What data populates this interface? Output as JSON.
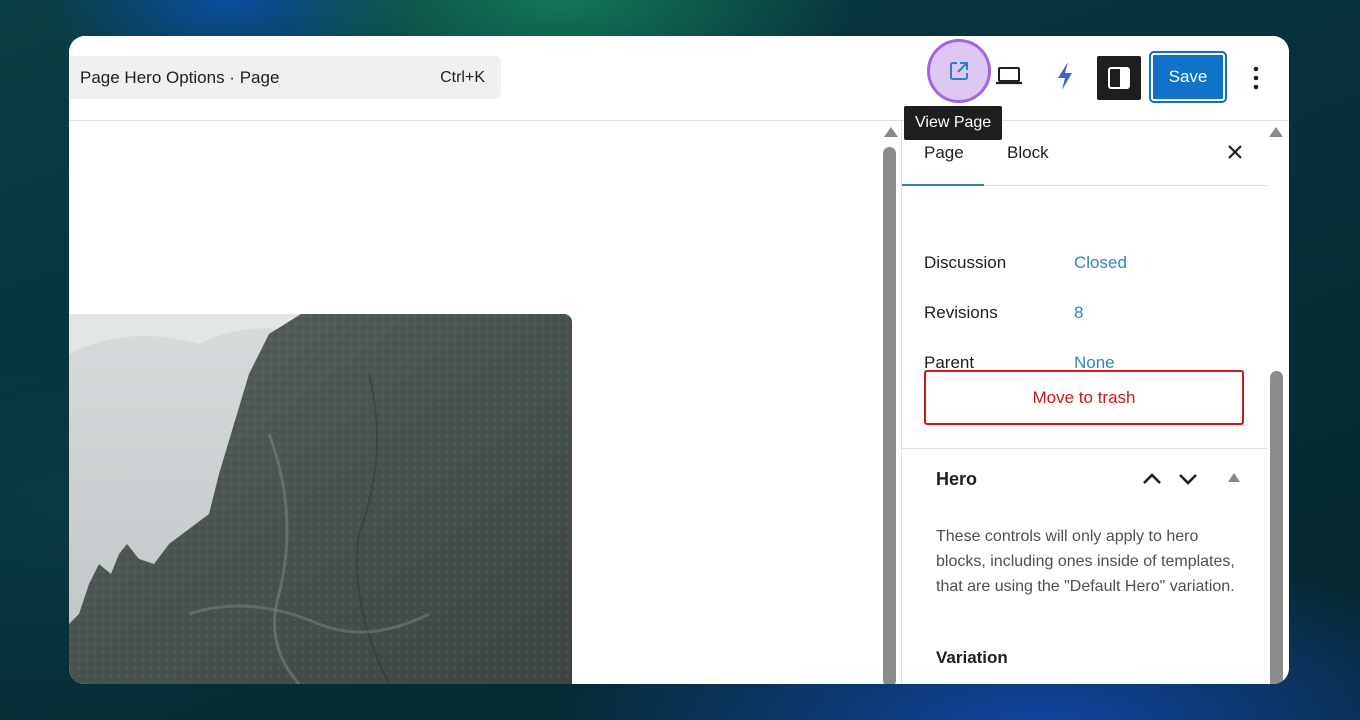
{
  "header": {
    "command_bar": {
      "title": "Page Hero Options · Page",
      "shortcut": "Ctrl+K"
    },
    "tooltip": "View Page",
    "save_label": "Save"
  },
  "sidebar": {
    "tabs": [
      {
        "label": "Page"
      },
      {
        "label": "Block"
      }
    ],
    "rows": [
      {
        "label": "Discussion",
        "value": "Closed"
      },
      {
        "label": "Revisions",
        "value": "8"
      },
      {
        "label": "Parent",
        "value": "None"
      }
    ],
    "trash_label": "Move to trash",
    "hero_panel": {
      "title": "Hero",
      "description": "These controls will only apply to hero blocks, including ones inside of templates, that are using the \"Default Hero\" variation.",
      "variation_label": "Variation"
    }
  },
  "colors": {
    "accent": "#0f72c8",
    "link": "#2f86c4",
    "danger": "#cc1818",
    "highlight": "#a563e0"
  }
}
